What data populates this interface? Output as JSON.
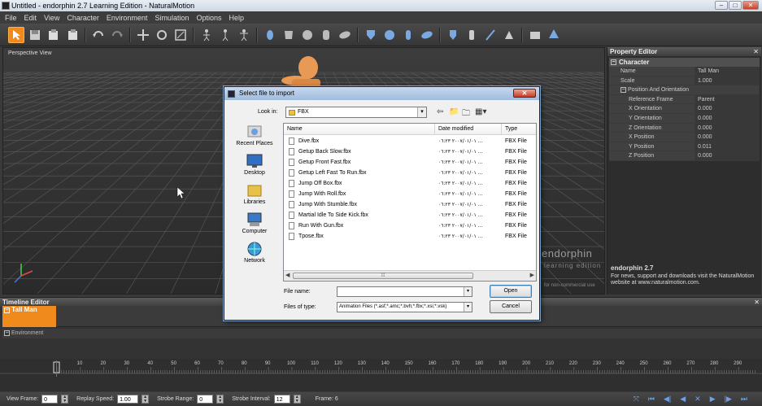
{
  "app": {
    "title": "Untitled - endorphin 2.7 Learning Edition - NaturalMotion",
    "menu": [
      "File",
      "Edit",
      "View",
      "Character",
      "Environment",
      "Simulation",
      "Options",
      "Help"
    ]
  },
  "viewport": {
    "label": "Perspective View"
  },
  "logo": {
    "name": "endorphin",
    "sub": "learning edition",
    "url": "for non-commercial use"
  },
  "property_editor": {
    "title": "Property Editor",
    "section": "Character",
    "rows": [
      {
        "name": "Name",
        "value": "Tall Man"
      },
      {
        "name": "Scale",
        "value": "1.000"
      }
    ],
    "subsection": "Position And Orientation",
    "subrows": [
      {
        "name": "Reference Frame",
        "value": "Parent"
      },
      {
        "name": "X Orientation",
        "value": "0.000"
      },
      {
        "name": "Y Orientation",
        "value": "0.000"
      },
      {
        "name": "Z Orientation",
        "value": "0.000"
      },
      {
        "name": "X Position",
        "value": "0.000"
      },
      {
        "name": "Y Position",
        "value": "0.011"
      },
      {
        "name": "Z Position",
        "value": "0.000"
      }
    ],
    "info_title": "endorphin 2.7",
    "info_text": "For news, support and downloads visit the NaturalMotion website at www.naturalmotion.com."
  },
  "timeline": {
    "title": "Timeline Editor",
    "track1": "Tall Man",
    "track2": "Environment",
    "ticks": [
      "10",
      "20",
      "30",
      "40",
      "50",
      "60",
      "70",
      "80",
      "90",
      "100",
      "110",
      "120",
      "130",
      "140",
      "150",
      "160",
      "170",
      "180",
      "190",
      "200",
      "210",
      "220",
      "230",
      "240",
      "250",
      "260",
      "270",
      "280",
      "290"
    ]
  },
  "statusbar": {
    "view_frame_label": "View Frame:",
    "view_frame": "0",
    "replay_speed_label": "Replay Speed:",
    "replay_speed": "1.00",
    "strobe_range_label": "Strobe Range:",
    "strobe_range": "0",
    "strobe_interval_label": "Strobe Interval:",
    "strobe_interval": "12",
    "frame": "Frame: 6"
  },
  "dialog": {
    "title": "Select file to import",
    "look_in_label": "Look in:",
    "look_in": "FBX",
    "places": [
      "Recent Places",
      "Desktop",
      "Libraries",
      "Computer",
      "Network"
    ],
    "columns": [
      "Name",
      "Date modified",
      "Type"
    ],
    "files": [
      {
        "name": "Dive.fbx",
        "date": "٢٠٠٧/٠١/٠١ ٠٦:٢٣ ...",
        "type": "FBX File"
      },
      {
        "name": "Getup Back Slow.fbx",
        "date": "٢٠٠٧/٠١/٠١ ٠٦:٢٣ ...",
        "type": "FBX File"
      },
      {
        "name": "Getup Front Fast.fbx",
        "date": "٢٠٠٧/٠١/٠١ ٠٦:٢٣ ...",
        "type": "FBX File"
      },
      {
        "name": "Getup Left Fast To Run.fbx",
        "date": "٢٠٠٧/٠١/٠١ ٠٦:٢٣ ...",
        "type": "FBX File"
      },
      {
        "name": "Jump Off Box.fbx",
        "date": "٢٠٠٧/٠١/٠١ ٠٦:٢٣ ...",
        "type": "FBX File"
      },
      {
        "name": "Jump With Roll.fbx",
        "date": "٢٠٠٧/٠١/٠١ ٠٦:٢٣ ...",
        "type": "FBX File"
      },
      {
        "name": "Jump With Stumble.fbx",
        "date": "٢٠٠٧/٠١/٠١ ٠٦:٢٣ ...",
        "type": "FBX File"
      },
      {
        "name": "Martial Idle To Side Kick.fbx",
        "date": "٢٠٠٧/٠١/٠١ ٠٦:٢٣ ...",
        "type": "FBX File"
      },
      {
        "name": "Run With Gun.fbx",
        "date": "٢٠٠٧/٠١/٠١ ٠٦:٢٣ ...",
        "type": "FBX File"
      },
      {
        "name": "Tpose.fbx",
        "date": "٢٠٠٧/٠١/٠١ ٠٦:٢٣ ...",
        "type": "FBX File"
      }
    ],
    "file_name_label": "File name:",
    "file_name": "",
    "file_type_label": "Files of type:",
    "file_type": "Animation Files (*.asf;*.amc;*.bvh;*.fbx;*.xsi;*.vsk)",
    "open": "Open",
    "cancel": "Cancel"
  }
}
